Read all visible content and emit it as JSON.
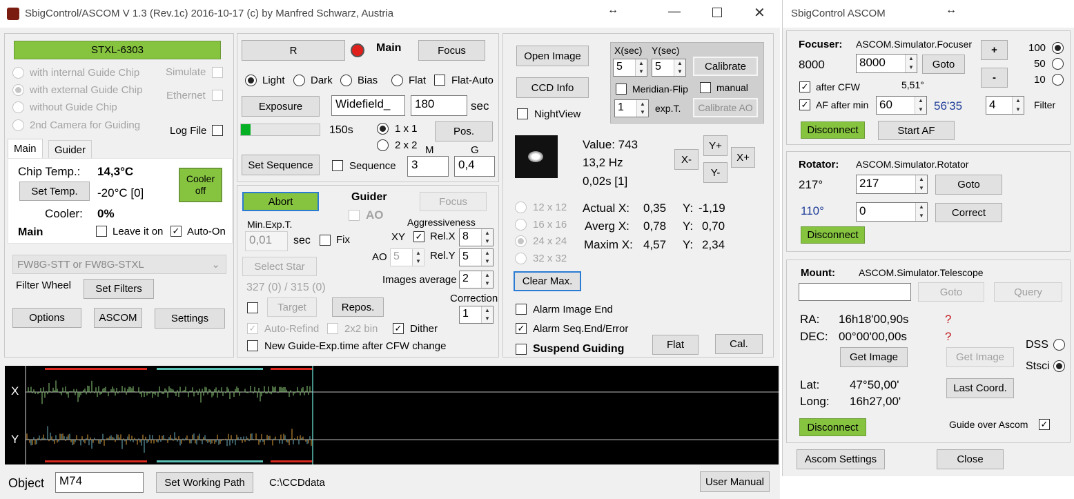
{
  "main_window": {
    "title": "SbigControl/ASCOM V 1.3 (Rev.1c) 2016-10-17 (c) by Manfred Schwarz, Austria",
    "camera_label": "STXL-6303",
    "guide_chip_options": [
      "with internal Guide Chip",
      "with external Guide Chip",
      "without Guide Chip",
      "2nd Camera for Guiding"
    ],
    "simulate_label": "Simulate",
    "ethernet_label": "Ethernet",
    "logfile_label": "Log File",
    "tabs": [
      "Main",
      "Guider"
    ],
    "chip_temp_label": "Chip Temp.:",
    "chip_temp_value": "14,3°C",
    "set_temp_button": "Set Temp.",
    "set_temp_value": "-20°C [0]",
    "cooler_button": "Cooler off",
    "cooler_label": "Cooler:",
    "cooler_value": "0%",
    "main_label": "Main",
    "leave_on_label": "Leave it on",
    "auto_on_label": "Auto-On",
    "filter_select": "FW8G-STT or FW8G-STXL",
    "filter_wheel_label": "Filter Wheel",
    "set_filters_button": "Set Filters",
    "options_button": "Options",
    "ascom_button": "ASCOM",
    "settings_button": "Settings",
    "filter_r_button": "R",
    "main_title": "Main",
    "focus_button": "Focus",
    "frame_types": [
      "Light",
      "Dark",
      "Bias",
      "Flat"
    ],
    "flat_auto_label": "Flat-Auto",
    "exposure_button": "Exposure",
    "exposure_name": "Widefield_",
    "exposure_time": "180",
    "sec_label": "sec",
    "progress": 0.12,
    "progress_text": "150s",
    "binning": [
      "1 x 1",
      "2 x 2"
    ],
    "pos_button": "Pos.",
    "m_label": "M",
    "g_label": "G",
    "set_sequence_button": "Set Sequence",
    "sequence_label": "Sequence",
    "m_value": "3",
    "g_value": "0,4",
    "abort_button": "Abort",
    "guider_title": "Guider",
    "guider_focus_button": "Focus",
    "ao_label": "AO",
    "min_exp_label": "Min.Exp.T.",
    "min_exp_value": "0,01",
    "min_exp_sec": "sec",
    "fix_label": "Fix",
    "aggressiveness_label": "Aggressiveness",
    "xy_label": "XY",
    "relx_label": "Rel.X",
    "relx_value": "8",
    "ao_row_label": "AO",
    "ao_value": "5",
    "rely_label": "Rel.Y",
    "rely_value": "5",
    "select_star_button": "Select Star",
    "star_counts": "327 (0) / 315 (0)",
    "images_average_label": "Images average",
    "images_average_value": "2",
    "correction_label": "Correction",
    "correction_value": "1",
    "target_button": "Target",
    "repos_button": "Repos.",
    "auto_refind_label": "Auto-Refind",
    "bin2x2_label": "2x2 bin",
    "dither_label": "Dither",
    "new_guide_exp_label": "New Guide-Exp.time after CFW change",
    "open_image_button": "Open Image",
    "ccd_info_button": "CCD Info",
    "nightview_label": "NightView",
    "xsec_label": "X(sec)",
    "ysec_label": "Y(sec)",
    "xsec_value": "5",
    "ysec_value": "5",
    "calibrate_button": "Calibrate",
    "meridian_flip_label": "Meridian-Flip",
    "manual_label": "manual",
    "expt_value": "1",
    "expt_label": "exp.T.",
    "calibrate_ao_button": "Calibrate AO",
    "value_text": "Value: 743",
    "hz_text": "13,2 Hz",
    "time_text": "0,02s [1]",
    "y_plus": "Y+",
    "x_minus": "X-",
    "x_plus": "X+",
    "y_minus": "Y-",
    "box_sizes": [
      "12 x 12",
      "16 x 16",
      "24 x 24",
      "32 x 32"
    ],
    "actual_x": "Actual X:",
    "actual_x_val": "0,35",
    "actual_y": "Y:",
    "actual_y_val": "-1,19",
    "averg_x": "Averg X:",
    "averg_x_val": "0,78",
    "averg_y": "Y:",
    "averg_y_val": "0,70",
    "maxim_x": "Maxim X:",
    "maxim_x_val": "4,57",
    "maxim_y": "Y:",
    "maxim_y_val": "2,34",
    "clear_max_button": "Clear Max.",
    "alarm_image_end_label": "Alarm Image End",
    "alarm_seq_label": "Alarm Seq.End/Error",
    "suspend_guiding_label": "Suspend Guiding",
    "flat_button": "Flat",
    "cal_button": "Cal.",
    "graph_x_label": "X",
    "graph_y_label": "Y",
    "object_label": "Object",
    "object_value": "M74",
    "set_working_path_button": "Set Working Path",
    "working_path": "C:\\CCDdata",
    "user_manual_button": "User Manual",
    "colors": {
      "green": "#86c440",
      "graph_bg": "#000000",
      "graph_line": "#5bc2b8",
      "graph_red": "#d9271e"
    }
  },
  "ascom_window": {
    "title": "SbigControl ASCOM",
    "focuser_label": "Focuser:",
    "focuser_name": "ASCOM.Simulator.Focuser",
    "focuser_pos": "8000",
    "focuser_target": "8000",
    "goto_button": "Goto",
    "plus_button": "+",
    "minus_button": "-",
    "step_options": [
      "100",
      "50",
      "10"
    ],
    "after_cfw_label": "after CFW",
    "temp_value": "5,51°",
    "af_after_min_label": "AF after min",
    "af_min_value": "60",
    "af_time": "56'35",
    "filter_value": "4",
    "filter_label": "Filter",
    "focuser_disconnect": "Disconnect",
    "start_af_button": "Start AF",
    "rotator_label": "Rotator:",
    "rotator_name": "ASCOM.Simulator.Rotator",
    "rotator_pos": "217°",
    "rotator_target": "217",
    "rotator_goto": "Goto",
    "rotator_offset": "110°",
    "rotator_correct_value": "0",
    "correct_button": "Correct",
    "rotator_disconnect": "Disconnect",
    "mount_label": "Mount:",
    "mount_name": "ASCOM.Simulator.Telescope",
    "mount_goto": "Goto",
    "mount_query": "Query",
    "ra_label": "RA:",
    "ra_value": "16h18'00,90s",
    "dec_label": "DEC:",
    "dec_value": "00°00'00,00s",
    "question": "?",
    "dss_label": "DSS",
    "stsci_label": "Stsci",
    "get_image_button": "Get Image",
    "get_image_dis_button": "Get Image",
    "lat_label": "Lat:",
    "lat_value": "47°50,00'",
    "long_label": "Long:",
    "long_value": "16h27,00'",
    "last_coord_button": "Last Coord.",
    "mount_disconnect": "Disconnect",
    "guide_over_ascom_label": "Guide over Ascom",
    "ascom_settings_button": "Ascom Settings",
    "close_button": "Close"
  }
}
